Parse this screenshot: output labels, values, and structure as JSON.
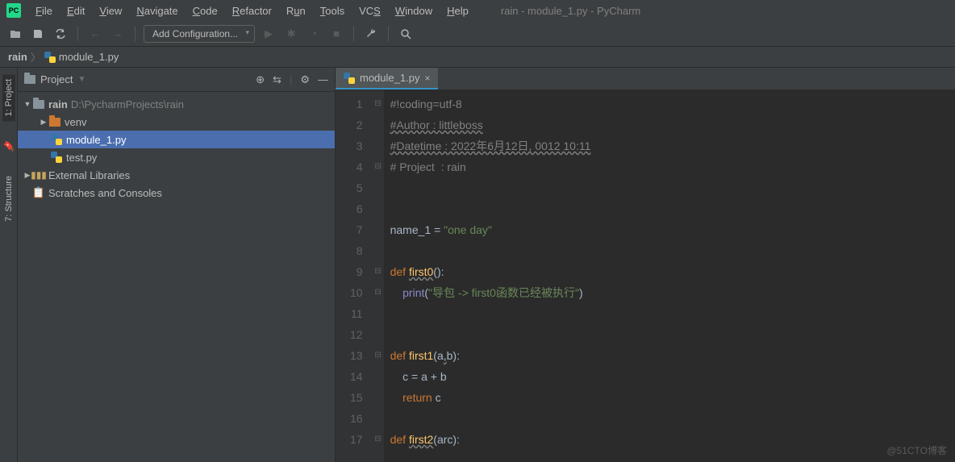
{
  "window_title": "rain - module_1.py - PyCharm",
  "menu": [
    "File",
    "Edit",
    "View",
    "Navigate",
    "Code",
    "Refactor",
    "Run",
    "Tools",
    "VCS",
    "Window",
    "Help"
  ],
  "config_button": "Add Configuration...",
  "breadcrumb": {
    "project": "rain",
    "file": "module_1.py"
  },
  "left_tabs": {
    "project": "1: Project",
    "structure": "7: Structure"
  },
  "panel": {
    "title": "Project",
    "root": {
      "name": "rain",
      "path": "D:\\PycharmProjects\\rain"
    },
    "venv": "venv",
    "module1": "module_1.py",
    "test": "test.py",
    "ext_lib": "External Libraries",
    "scratch": "Scratches and Consoles"
  },
  "tab": {
    "name": "module_1.py"
  },
  "code": {
    "lines": [
      "1",
      "2",
      "3",
      "4",
      "5",
      "6",
      "7",
      "8",
      "9",
      "10",
      "11",
      "12",
      "13",
      "14",
      "15",
      "16",
      "17"
    ],
    "l1": "#!coding=utf-8",
    "l2": "#Author : littleboss",
    "l3": "#Datetime : 2022年6月12日, 0012 10:11",
    "l4_a": "# Project  : ",
    "l4_b": "rain",
    "l7_a": "name_1 ",
    "l7_b": "= ",
    "l7_c": "\"one day\"",
    "l9_a": "def ",
    "l9_b": "first0",
    "l9_c": "():",
    "l10_a": "    ",
    "l10_b": "print",
    "l10_c": "(",
    "l10_d": "\"导包 -> first0函数已经被执行\"",
    "l10_e": ")",
    "l13_a": "def ",
    "l13_b": "first1",
    "l13_c": "(a",
    "l13_d": ",",
    "l13_e": "b):",
    "l14": "    c = a + b",
    "l15_a": "    ",
    "l15_b": "return ",
    "l15_c": "c",
    "l17_a": "def ",
    "l17_b": "first2",
    "l17_c": "(arc):"
  },
  "watermark": "@51CTO博客"
}
